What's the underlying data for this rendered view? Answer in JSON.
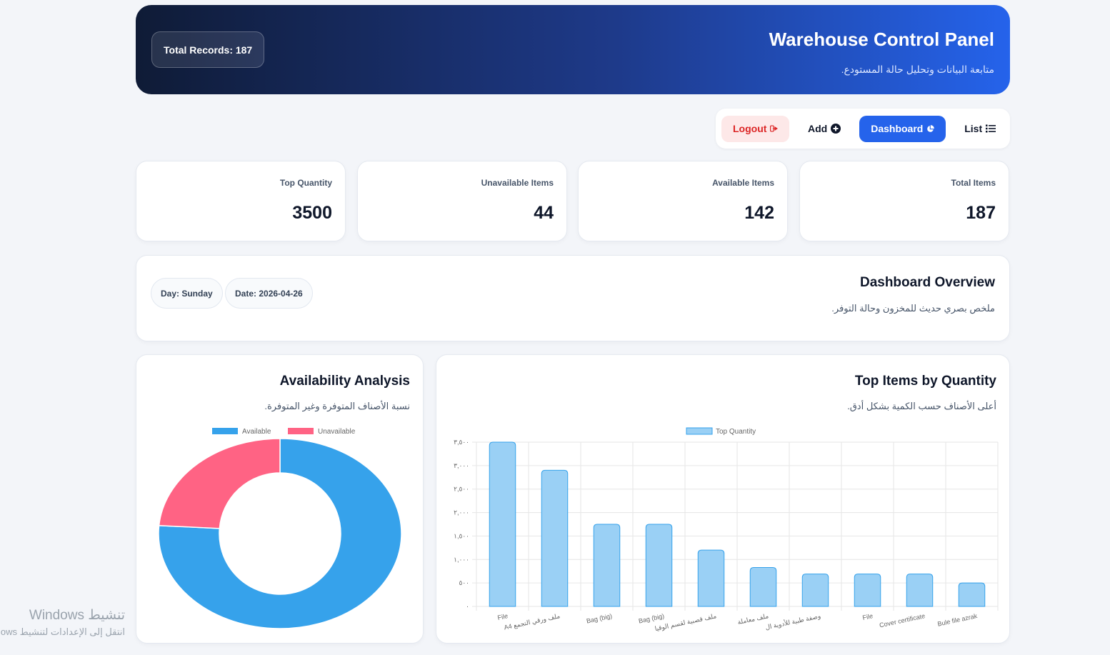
{
  "header": {
    "title": "Warehouse Control Panel",
    "subtitle": "متابعة البيانات وتحليل حالة المستودع.",
    "total_records": "Total Records: 187"
  },
  "nav": {
    "logout": "Logout",
    "add": "Add",
    "dashboard": "Dashboard",
    "list": "List"
  },
  "stats": [
    {
      "label": "Top Quantity",
      "value": "3500"
    },
    {
      "label": "Unavailable Items",
      "value": "44"
    },
    {
      "label": "Available Items",
      "value": "142"
    },
    {
      "label": "Total Items",
      "value": "187"
    }
  ],
  "overview": {
    "title": "Dashboard Overview",
    "subtitle": "ملخص بصري حديث للمخزون وحالة التوفر.",
    "day": "Day: Sunday",
    "date": "Date: 2026-04-26"
  },
  "availability": {
    "title": "Availability Analysis",
    "subtitle": "نسبة الأصناف المتوفرة وغير المتوفرة."
  },
  "top_items": {
    "title": "Top Items by Quantity",
    "subtitle": "أعلى الأصناف حسب الكمية بشكل أدق."
  },
  "chart_data": [
    {
      "type": "pie",
      "labels": [
        "Available",
        "Unavailable"
      ],
      "values": [
        142,
        44
      ],
      "colors": [
        "#36a2eb",
        "#ff6384"
      ],
      "legend": "top"
    },
    {
      "type": "bar",
      "series": [
        {
          "name": "Top Quantity",
          "values": [
            3500,
            2900,
            1750,
            1750,
            1200,
            830,
            690,
            690,
            690,
            500
          ]
        }
      ],
      "categories": [
        "File",
        "A4 ملف ورقي التجمع",
        "Bag (big)",
        "Bag (big)",
        "ملف قصبية لقسم الوقيا",
        "ملف معاملة",
        "وصفة طبية للأدوية ال",
        "File",
        "Cover certificate",
        "Bule file azrak"
      ],
      "ylim": [
        0,
        3500
      ],
      "yticks": [
        "٠",
        "٥٠٠",
        "١,٠٠٠",
        "١,٥٠٠",
        "٢,٠٠٠",
        "٢,٥٠٠",
        "٣,٠٠٠",
        "٣,٥٠٠"
      ],
      "color": "#9ad0f5",
      "border_color": "#36a2eb",
      "grid": true,
      "legend": "top"
    }
  ],
  "watermark": {
    "line1": "تنشيط Windows",
    "line2": "انتقل إلى الإعدادات لتنشيط Windows."
  }
}
